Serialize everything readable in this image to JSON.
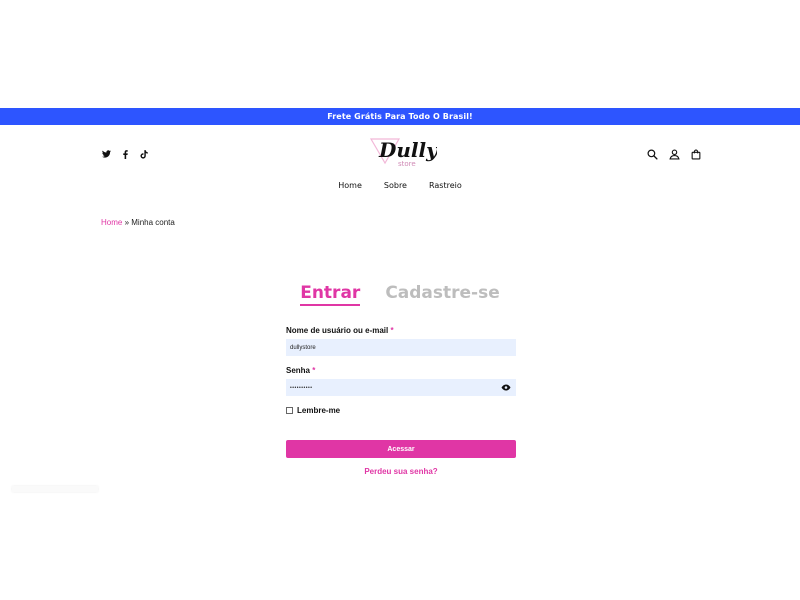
{
  "announcement": "Frete Grátis Para Todo O Brasil!",
  "social_icons": [
    "twitter-icon",
    "facebook-icon",
    "tiktok-icon"
  ],
  "logo": {
    "text": "Dully",
    "sub": "store"
  },
  "header_icons": [
    "search-icon",
    "account-icon",
    "cart-icon"
  ],
  "nav": {
    "items": [
      {
        "label": "Home"
      },
      {
        "label": "Sobre"
      },
      {
        "label": "Rastreio"
      }
    ]
  },
  "breadcrumb": {
    "home": "Home",
    "separator": " » ",
    "current": "Minha conta"
  },
  "tabs": {
    "login": "Entrar",
    "register": "Cadastre-se"
  },
  "form": {
    "username_label": "Nome de usuário ou e-mail",
    "username_value": "dullystore",
    "password_label": "Senha",
    "password_value": "••••••••••",
    "required_mark": "*",
    "remember_label": "Lembre-me",
    "submit_label": "Acessar",
    "forgot_label": "Perdeu sua senha?"
  },
  "colors": {
    "accent": "#e036a5",
    "topbar": "#2d55ff",
    "input_bg": "#e8f0fe",
    "inactive_tab": "#bdbdbd"
  }
}
